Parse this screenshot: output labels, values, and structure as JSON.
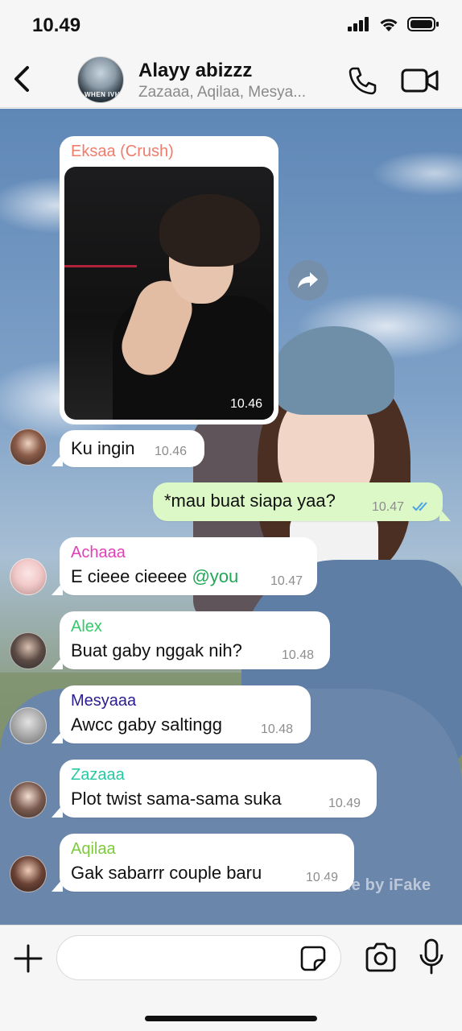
{
  "status_bar": {
    "time": "10.49"
  },
  "header": {
    "title": "Alayy abizzz",
    "members": "Zazaaa, Aqilaa, Mesya...",
    "avatar_tag": "WHEN IVH"
  },
  "colors": {
    "out_bubble": "#dcf8c6",
    "tick": "#4aa3e6",
    "eksaa": "#f27c6b",
    "achaaa": "#e23fb6",
    "alex": "#36c96a",
    "mesyaaa": "#2b1c8f",
    "zazaaa": "#27c9a4",
    "aqilaa": "#7ccb3d"
  },
  "messages": [
    {
      "type": "image",
      "sender": "Eksaa (Crush)",
      "time": "10.46"
    },
    {
      "type": "text",
      "sender": "",
      "text": "Ku ingin",
      "time": "10.46"
    },
    {
      "type": "text",
      "outgoing": true,
      "text": "*mau buat siapa yaa?",
      "time": "10.47",
      "status": "read"
    },
    {
      "type": "text",
      "sender": "Achaaa",
      "text": "E cieee cieeee ",
      "mention": "@you",
      "time": "10.47"
    },
    {
      "type": "text",
      "sender": "Alex",
      "text": "Buat gaby nggak nih?",
      "time": "10.48"
    },
    {
      "type": "text",
      "sender": "Mesyaaa",
      "text": "Awcc gaby saltingg",
      "time": "10.48"
    },
    {
      "type": "text",
      "sender": "Zazaaa",
      "text": "Plot twist sama-sama suka",
      "time": "10.49"
    },
    {
      "type": "text",
      "sender": "Aqilaa",
      "text": "Gak sabarrr couple baru",
      "time": "10.49"
    }
  ],
  "watermark": "Made by iFake",
  "input": {
    "value": "",
    "placeholder": ""
  },
  "icons": {
    "back": "chevron-left-icon",
    "call": "phone-icon",
    "video": "video-camera-icon",
    "forward": "forward-arrow-icon",
    "plus": "plus-icon",
    "sticker": "sticker-icon",
    "camera": "camera-icon",
    "mic": "microphone-icon"
  }
}
